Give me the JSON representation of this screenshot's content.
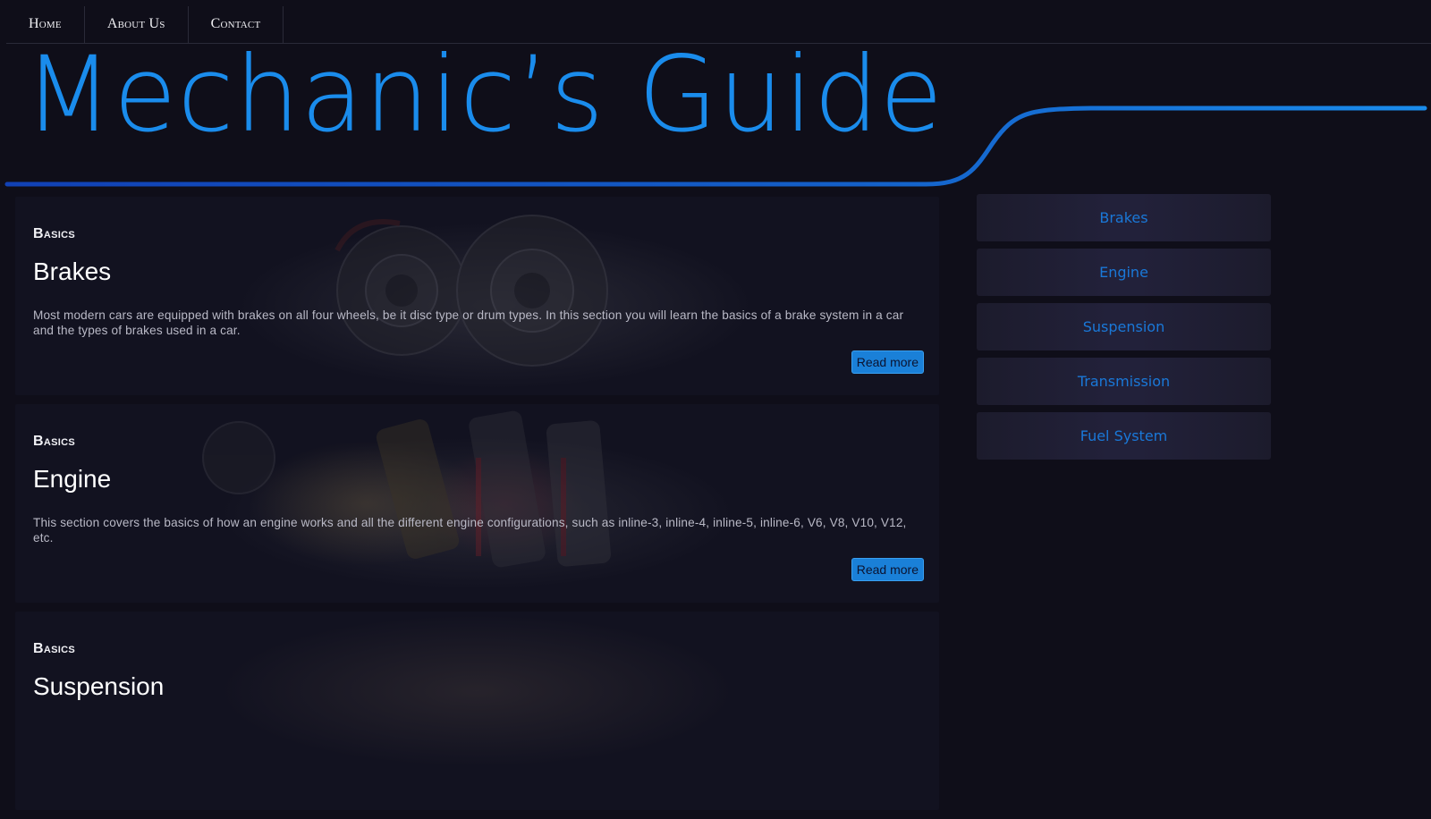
{
  "nav": {
    "items": [
      {
        "label": "Home"
      },
      {
        "label": "About Us"
      },
      {
        "label": "Contact"
      }
    ]
  },
  "header": {
    "title": "Mechanic’s Guide",
    "accent_color": "#1a8cec"
  },
  "articles": [
    {
      "kicker": "Basics",
      "title": "Brakes",
      "text": "Most modern cars are equipped with brakes on all four wheels, be it disc type or drum types. In this section you will learn the basics of a brake system in a car and the types of brakes used in a car.",
      "button": "Read more",
      "image": "brake-discs-image"
    },
    {
      "kicker": "Basics",
      "title": "Engine",
      "text": "This section covers the basics of how an engine works and all the different engine configurations, such as inline-3, inline-4, inline-5, inline-6, V6, V8, V10, V12, etc.",
      "button": "Read more",
      "image": "engine-pistons-image"
    },
    {
      "kicker": "Basics",
      "title": "Suspension",
      "text": "",
      "button": "",
      "image": "suspension-image"
    }
  ],
  "sidebar": {
    "items": [
      {
        "label": "Brakes"
      },
      {
        "label": "Engine"
      },
      {
        "label": "Suspension"
      },
      {
        "label": "Transmission"
      },
      {
        "label": "Fuel System"
      }
    ]
  },
  "colors": {
    "background": "#0f0e19",
    "accent": "#1a8cec",
    "button": "#1a80d8",
    "sidebar_text": "#1a78d8"
  }
}
